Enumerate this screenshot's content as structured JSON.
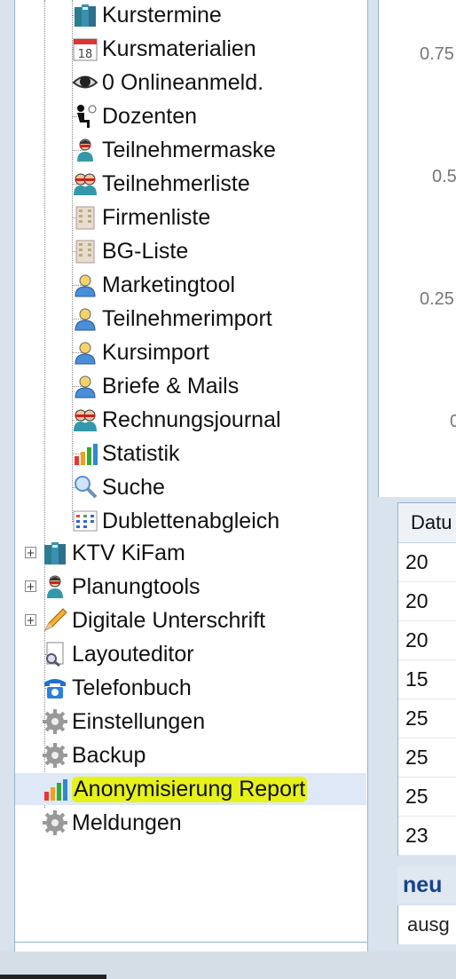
{
  "tree": {
    "items": [
      {
        "label": "Kurstermine",
        "icon": "book-icon"
      },
      {
        "label": "Kursmaterialien",
        "icon": "calendar-icon",
        "icon_text": "18"
      },
      {
        "label": "0 Onlineanmeld.",
        "icon": "eye-icon"
      },
      {
        "label": "Dozenten",
        "icon": "lecturer-icon"
      },
      {
        "label": "Teilnehmermaske",
        "icon": "person-icon"
      },
      {
        "label": "Teilnehmerliste",
        "icon": "people-icon"
      },
      {
        "label": "Firmenliste",
        "icon": "building-icon"
      },
      {
        "label": "BG-Liste",
        "icon": "building-icon"
      },
      {
        "label": "Marketingtool",
        "icon": "user-icon"
      },
      {
        "label": "Teilnehmerimport",
        "icon": "user-icon"
      },
      {
        "label": "Kursimport",
        "icon": "user-icon"
      },
      {
        "label": "Briefe & Mails",
        "icon": "user-icon"
      },
      {
        "label": "Rechnungsjournal",
        "icon": "people-icon"
      },
      {
        "label": "Statistik",
        "icon": "bar-chart-icon"
      },
      {
        "label": "Suche",
        "icon": "magnifier-icon"
      },
      {
        "label": "Dublettenabgleich",
        "icon": "table-icon"
      }
    ],
    "top_items": [
      {
        "label": "KTV KiFam",
        "icon": "book-icon",
        "expandable": true
      },
      {
        "label": "Planungtools",
        "icon": "person-icon",
        "expandable": true
      },
      {
        "label": "Digitale Unterschrift",
        "icon": "pencil-icon",
        "expandable": true
      },
      {
        "label": "Layouteditor",
        "icon": "document-search-icon",
        "expandable": false
      },
      {
        "label": "Telefonbuch",
        "icon": "telephone-icon",
        "expandable": false
      },
      {
        "label": "Einstellungen",
        "icon": "gear-icon",
        "expandable": false
      },
      {
        "label": "Backup",
        "icon": "gear-icon",
        "expandable": false
      },
      {
        "label": "Anonymisierung Report",
        "icon": "bar-chart-icon",
        "expandable": false,
        "selected": true
      },
      {
        "label": "Meldungen",
        "icon": "gear-icon",
        "expandable": false
      }
    ]
  },
  "chart": {
    "y_ticks": [
      "0.75",
      "0.5",
      "0.25",
      "0"
    ]
  },
  "grid": {
    "header": "Datu",
    "rows": [
      "20",
      "20",
      "20",
      "15",
      "25",
      "25",
      "25",
      "23"
    ]
  },
  "news": {
    "title": "neu",
    "body": "ausg"
  },
  "colors": {
    "highlight": "#e6f21a",
    "selected_row": "#dfe8f6",
    "panel_border": "#99b2cc",
    "news_title": "#15428b"
  }
}
